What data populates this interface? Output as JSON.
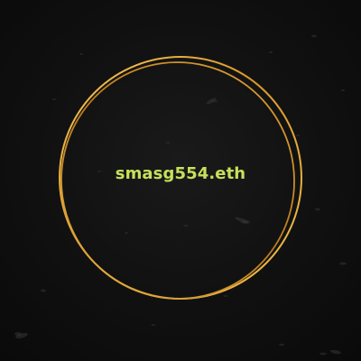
{
  "ens_name": "smasg554.eth",
  "colors": {
    "background": "#0d0d0d",
    "text": "#c6e05a",
    "ring_gold_light": "#f2c14e",
    "ring_gold_dark": "#b9791c"
  }
}
